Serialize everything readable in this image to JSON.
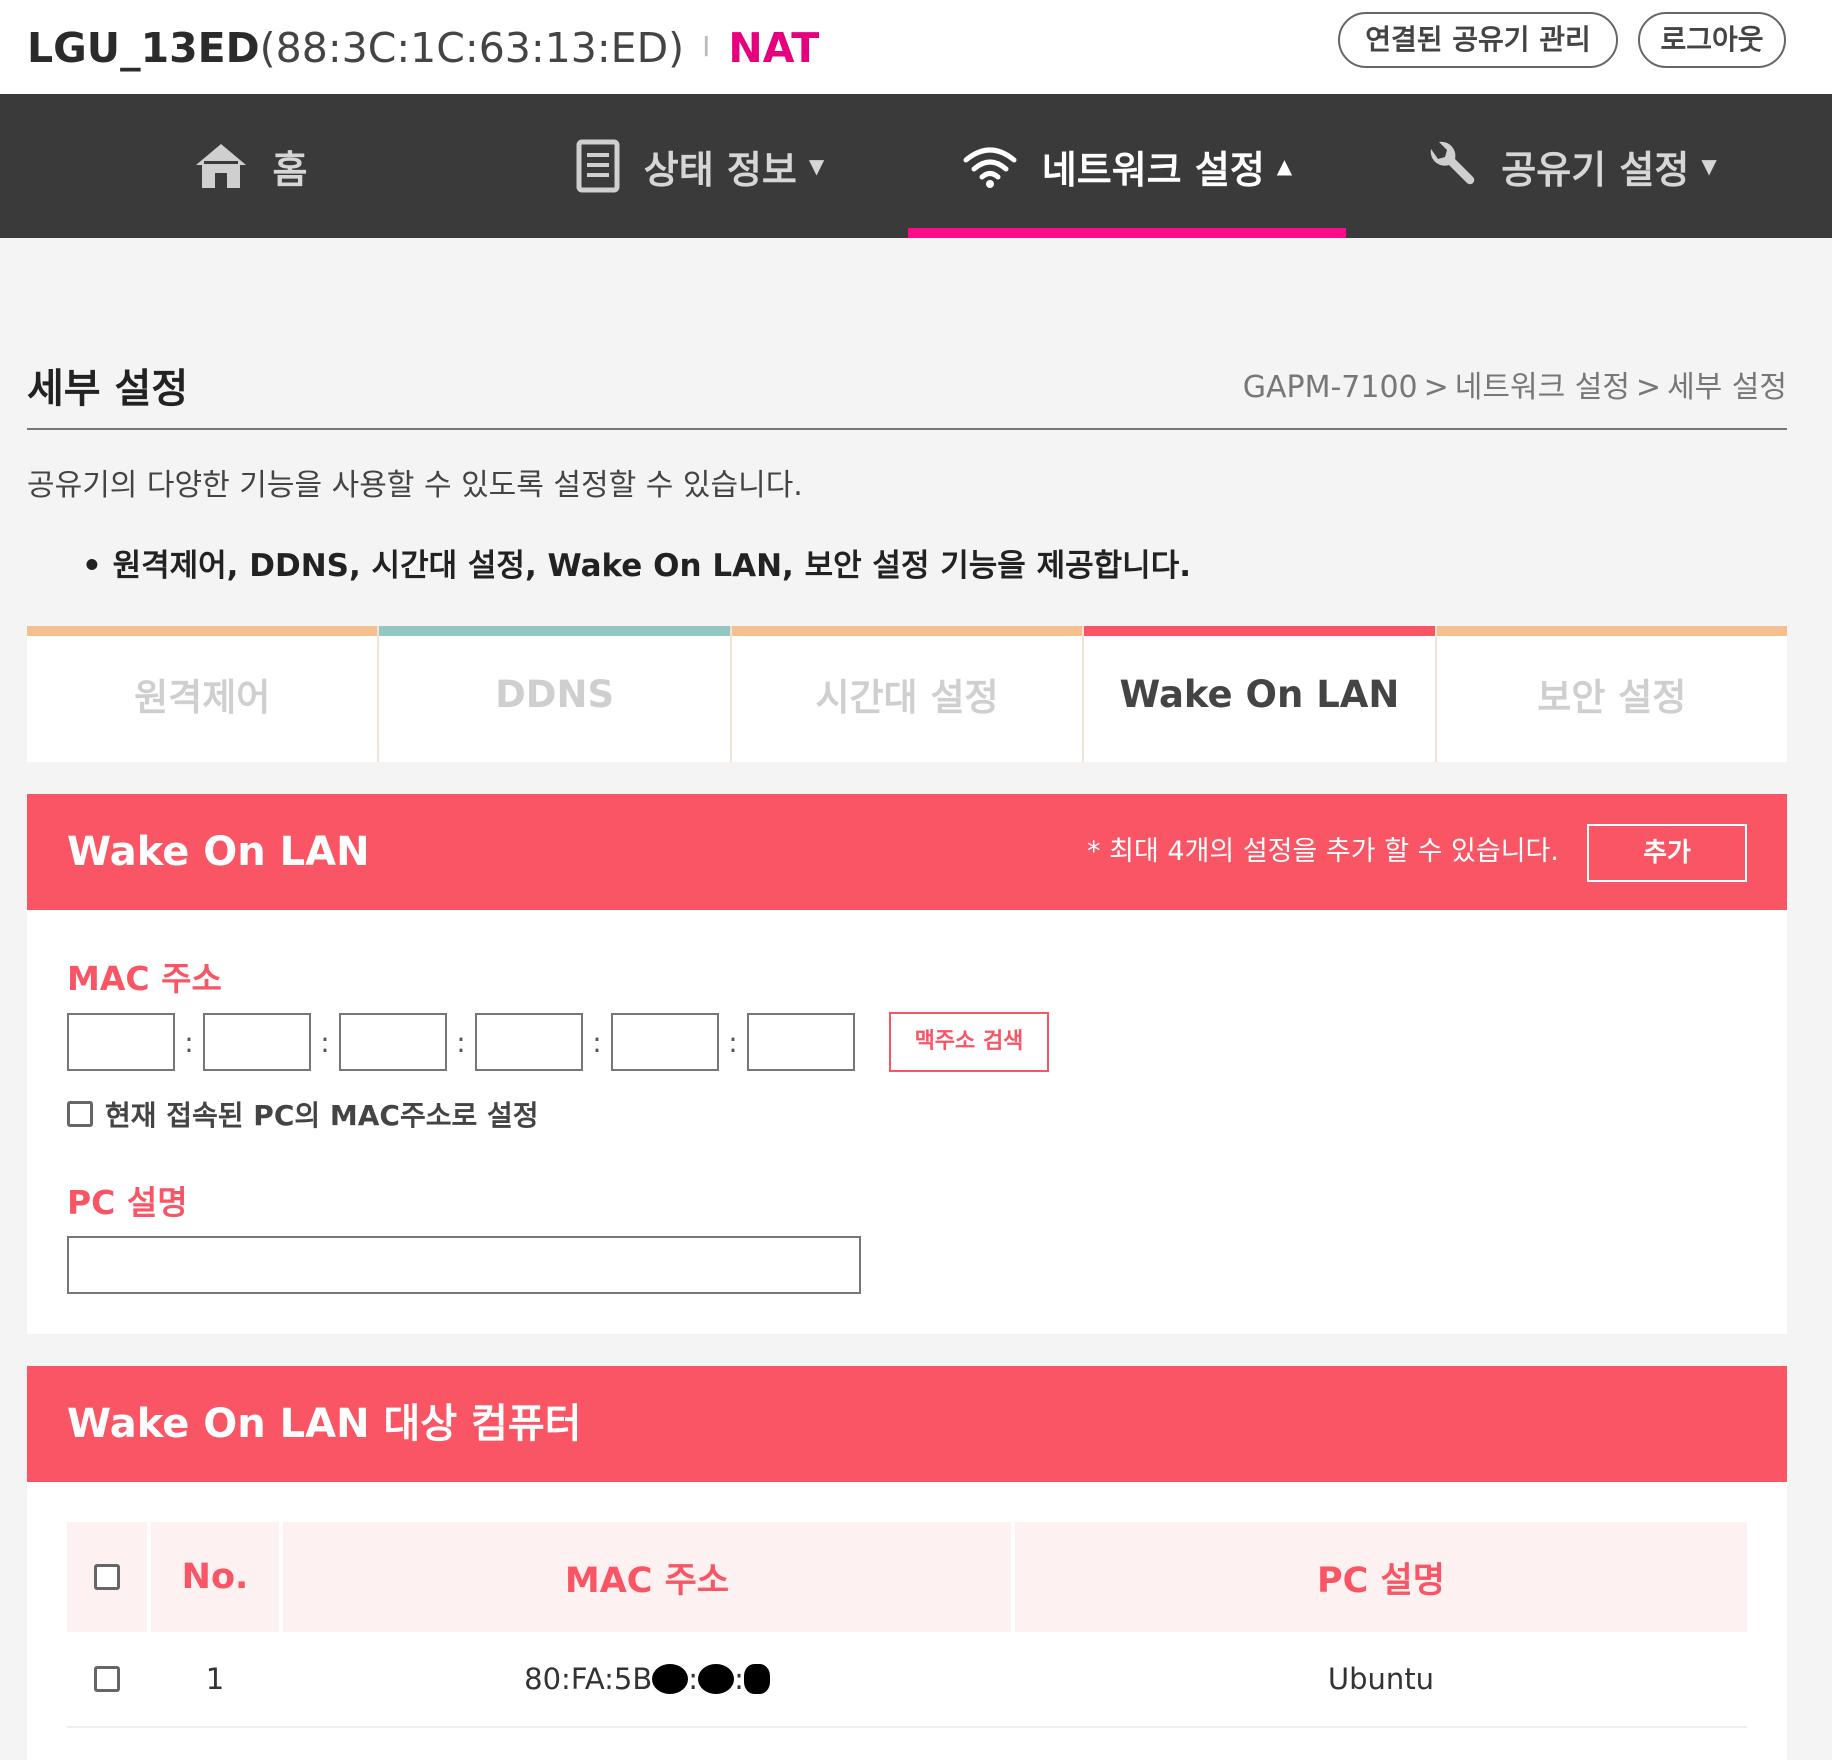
{
  "header": {
    "ssid": "LGU_13ED",
    "mac": "(88:3C:1C:63:13:ED)",
    "separator": "I",
    "mode": "NAT",
    "manage_button": "연결된 공유기 관리",
    "logout_button": "로그아웃"
  },
  "nav": {
    "home": "홈",
    "status": "상태 정보",
    "network": "네트워크 설정",
    "router": "공유기 설정"
  },
  "page": {
    "title": "세부 설정",
    "breadcrumb": [
      "GAPM-7100",
      "네트워크 설정",
      "세부 설정"
    ],
    "description": "공유기의 다양한 기능을 사용할 수 있도록 설정할 수 있습니다.",
    "bullet": "• 원격제어, DDNS, 시간대 설정, Wake On LAN, 보안 설정 기능을 제공합니다."
  },
  "subtabs": [
    {
      "label": "원격제어",
      "color": "#f6c08e"
    },
    {
      "label": "DDNS",
      "color": "#93c7c2"
    },
    {
      "label": "시간대 설정",
      "color": "#f6c08e"
    },
    {
      "label": "Wake On LAN",
      "color": "#f95565"
    },
    {
      "label": "보안 설정",
      "color": "#f6c08e"
    }
  ],
  "wol_form": {
    "title": "Wake On LAN",
    "note": "* 최대 4개의 설정을 추가 할 수 있습니다.",
    "add_button": "추가",
    "mac_label": "MAC 주소",
    "mac_search_button": "맥주소 검색",
    "use_current_pc_label": "현재 접속된 PC의 MAC주소로 설정",
    "pc_desc_label": "PC 설명"
  },
  "targets": {
    "title": "Wake On LAN 대상 컴퓨터",
    "columns": [
      "No.",
      "MAC 주소",
      "PC 설명"
    ],
    "rows": [
      {
        "no": "1",
        "mac_visible": "80:FA:5B",
        "description": "Ubuntu"
      }
    ]
  },
  "colors": {
    "accent_pink": "#ff0a8c",
    "panel_red": "#f95565",
    "nav_bg": "#3a3a3a"
  }
}
